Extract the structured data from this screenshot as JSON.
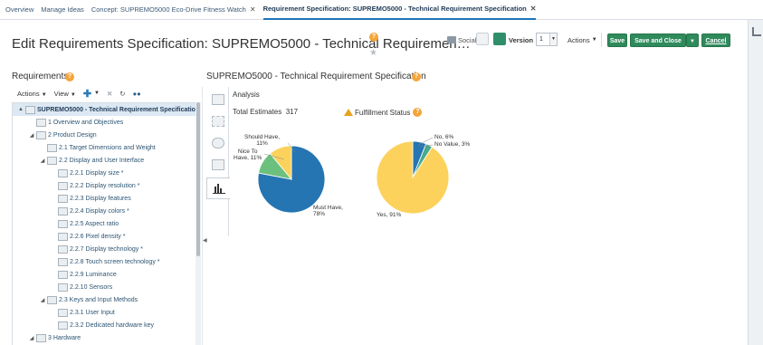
{
  "tabs": [
    {
      "label": "Overview",
      "closable": false,
      "active": false
    },
    {
      "label": "Manage Ideas",
      "closable": false,
      "active": false
    },
    {
      "label": "Concept: SUPREMO5000 Eco-Drive Fitness Watch",
      "closable": true,
      "active": false
    },
    {
      "label": "Requirement Specification: SUPREMO5000 - Technical Requirement Specification",
      "closable": true,
      "active": true
    }
  ],
  "header": {
    "title": "Edit Requirements Specification: SUPREMO5000 - Technical Requiremen…",
    "social_label": "Social",
    "version_label": "Version",
    "version_value": "1",
    "actions_label": "Actions",
    "save_label": "Save",
    "save_close_label": "Save and Close",
    "cancel_label": "Cancel"
  },
  "left": {
    "title": "Requirements",
    "toolbar": {
      "actions": "Actions",
      "view": "View"
    },
    "tree": [
      {
        "label": "SUPREMO5000 - Technical Requirement Specificatio",
        "level": 0,
        "toggle": "▲",
        "selected": true
      },
      {
        "label": "1 Overview and Objectives",
        "level": 1,
        "toggle": ""
      },
      {
        "label": "2 Product Design",
        "level": 1,
        "toggle": "◢"
      },
      {
        "label": "2.1 Target Dimensions and Weight",
        "level": 2,
        "toggle": ""
      },
      {
        "label": "2.2 Display and User Interface",
        "level": 2,
        "toggle": "◢"
      },
      {
        "label": "2.2.1 Display size *",
        "level": 3,
        "toggle": ""
      },
      {
        "label": "2.2.2 Display resolution *",
        "level": 3,
        "toggle": ""
      },
      {
        "label": "2.2.3 Display features",
        "level": 3,
        "toggle": ""
      },
      {
        "label": "2.2.4 Display colors *",
        "level": 3,
        "toggle": ""
      },
      {
        "label": "2.2.5 Aspect ratio",
        "level": 3,
        "toggle": ""
      },
      {
        "label": "2.2.6 Pixel density *",
        "level": 3,
        "toggle": ""
      },
      {
        "label": "2.2.7 Display technology *",
        "level": 3,
        "toggle": ""
      },
      {
        "label": "2.2.8 Touch screen technology *",
        "level": 3,
        "toggle": ""
      },
      {
        "label": "2.2.9 Luminance",
        "level": 3,
        "toggle": ""
      },
      {
        "label": "2.2.10 Sensors",
        "level": 3,
        "toggle": ""
      },
      {
        "label": "2.3 Keys and Input Methods",
        "level": 2,
        "toggle": "◢"
      },
      {
        "label": "2.3.1 User Input",
        "level": 3,
        "toggle": ""
      },
      {
        "label": "2.3.2 Dedicated hardware key",
        "level": 3,
        "toggle": ""
      },
      {
        "label": "3 Hardware",
        "level": 1,
        "toggle": "◢"
      }
    ]
  },
  "right": {
    "title": "SUPREMO5000 - Technical Requirement Specification",
    "analysis_label": "Analysis",
    "estimates_label": "Total Estimates",
    "estimates_value": "317",
    "fulfillment_label": "Fulfillment Status"
  },
  "colors": {
    "blue": "#2475b2",
    "green": "#6cc07d",
    "yellow": "#fcd25c",
    "teal": "#4aa98c",
    "save_green": "#2f8a5c"
  },
  "chart_data": [
    {
      "type": "pie",
      "slices": [
        {
          "label_lines": [
            "Must Have,",
            "78%"
          ],
          "value": 78,
          "color": "#2475b2"
        },
        {
          "label_lines": [
            "Nice To",
            "Have, 11%"
          ],
          "value": 11,
          "color": "#6cc07d"
        },
        {
          "label_lines": [
            "Should Have,",
            "11%"
          ],
          "value": 11,
          "color": "#fcd25c"
        }
      ]
    },
    {
      "type": "pie",
      "slices": [
        {
          "label_lines": [
            "No, 6%"
          ],
          "value": 6,
          "color": "#2475b2"
        },
        {
          "label_lines": [
            "No Value, 3%"
          ],
          "value": 3,
          "color": "#4aa98c"
        },
        {
          "label_lines": [
            "Yes, 91%"
          ],
          "value": 91,
          "color": "#fcd25c"
        }
      ]
    }
  ]
}
